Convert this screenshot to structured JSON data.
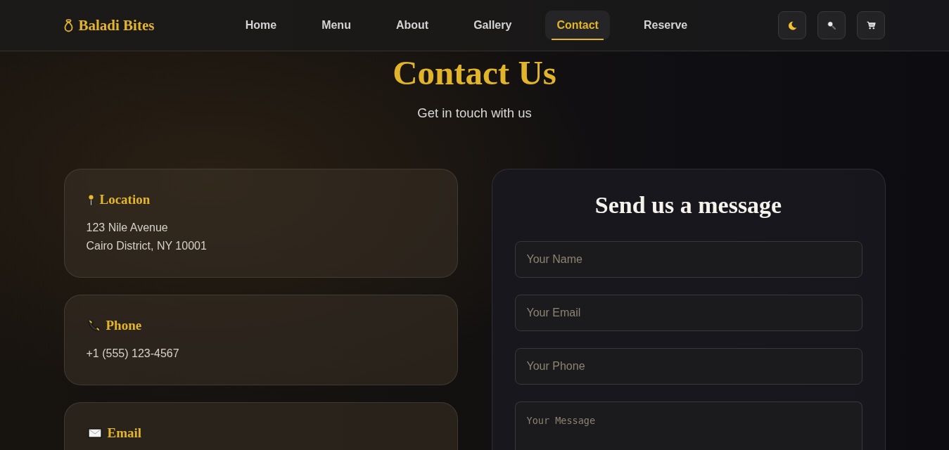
{
  "header": {
    "logo": "Baladi Bites",
    "nav": [
      {
        "label": "Home",
        "selected": false
      },
      {
        "label": "Menu",
        "selected": false
      },
      {
        "label": "About",
        "selected": false
      },
      {
        "label": "Gallery",
        "selected": false
      },
      {
        "label": "Contact",
        "selected": true
      },
      {
        "label": "Reserve",
        "selected": false
      }
    ],
    "actions": [
      {
        "kind": "theme"
      },
      {
        "kind": "search"
      },
      {
        "kind": "cart"
      }
    ]
  },
  "hero": {
    "title": "Contact Us",
    "subtitle": "Get in touch with us"
  },
  "contact_cards": [
    {
      "kind": "location",
      "title": "Location",
      "lines": [
        "123 Nile Avenue",
        "Cairo District, NY 10001"
      ]
    },
    {
      "kind": "phone",
      "title": "Phone",
      "lines": [
        "+1 (555) 123-4567"
      ]
    },
    {
      "kind": "email",
      "title": "Email"
    }
  ],
  "form": {
    "title": "Send us a message",
    "fields": [
      {
        "kind": "input",
        "placeholder": "Your Name"
      },
      {
        "kind": "input",
        "placeholder": "Your Email"
      },
      {
        "kind": "input",
        "placeholder": "Your Phone"
      },
      {
        "kind": "textarea",
        "placeholder": "Your Message"
      }
    ]
  }
}
